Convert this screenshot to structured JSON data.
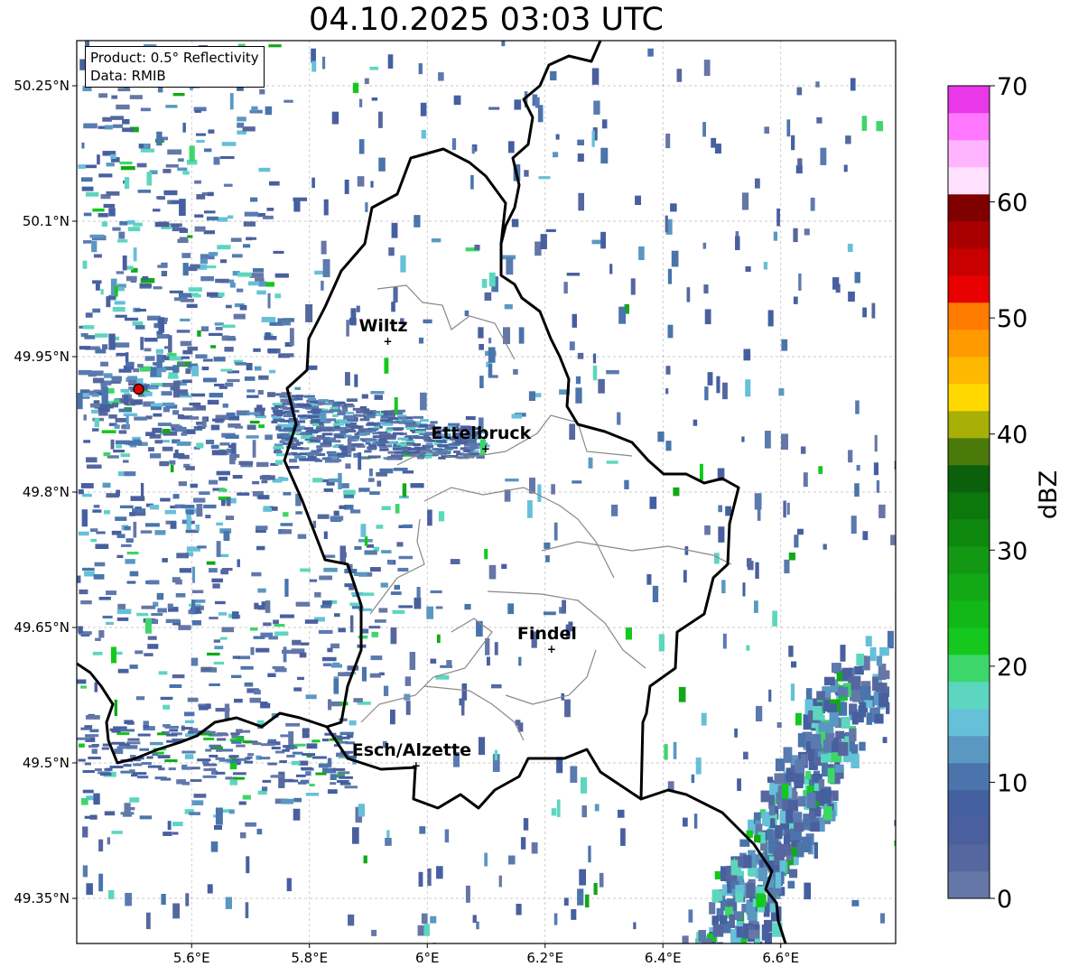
{
  "title": "04.10.2025 03:03 UTC",
  "info": {
    "product": "Product: 0.5° Reflectivity",
    "data_source": "Data: RMIB"
  },
  "map": {
    "lon_range": [
      5.405,
      6.795
    ],
    "lat_range": [
      49.3,
      50.3
    ],
    "x_ticks": [
      "5.6°E",
      "5.8°E",
      "6°E",
      "6.2°E",
      "6.4°E",
      "6.6°E"
    ],
    "x_tick_values": [
      5.6,
      5.8,
      6.0,
      6.2,
      6.4,
      6.6
    ],
    "y_ticks": [
      "49.35°N",
      "49.5°N",
      "49.65°N",
      "49.8°N",
      "49.95°N",
      "50.1°N",
      "50.25°N"
    ],
    "y_tick_values": [
      49.35,
      49.5,
      49.65,
      49.8,
      49.95,
      50.1,
      50.25
    ],
    "grid": true,
    "radar_site": {
      "lon": 5.51,
      "lat": 49.914
    },
    "cities": [
      {
        "name": "Wiltz",
        "lon": 5.933,
        "lat": 49.967
      },
      {
        "name": "Ettelbruck",
        "lon": 6.099,
        "lat": 49.848
      },
      {
        "name": "Findel",
        "lon": 6.211,
        "lat": 49.626
      },
      {
        "name": "Esch/Alzette",
        "lon": 5.981,
        "lat": 49.497
      }
    ]
  },
  "colorbar": {
    "label": "dBZ",
    "ticks": [
      "0",
      "10",
      "20",
      "30",
      "40",
      "50",
      "60",
      "70"
    ],
    "colors": [
      "#6577a6",
      "#55679e",
      "#4a5f9e",
      "#4560a0",
      "#4a74ab",
      "#5a98c2",
      "#66c0d8",
      "#5dd6bf",
      "#3dd66b",
      "#14c81e",
      "#12b818",
      "#12a816",
      "#129812",
      "#0f880f",
      "#0c780c",
      "#0b600b",
      "#4a7a0a",
      "#a8b008",
      "#ffd800",
      "#ffb800",
      "#ff9a00",
      "#ff7c00",
      "#e80000",
      "#c80000",
      "#a80000",
      "#800000",
      "#ffe0ff",
      "#ffb4ff",
      "#ff78ff",
      "#e838e8"
    ]
  }
}
